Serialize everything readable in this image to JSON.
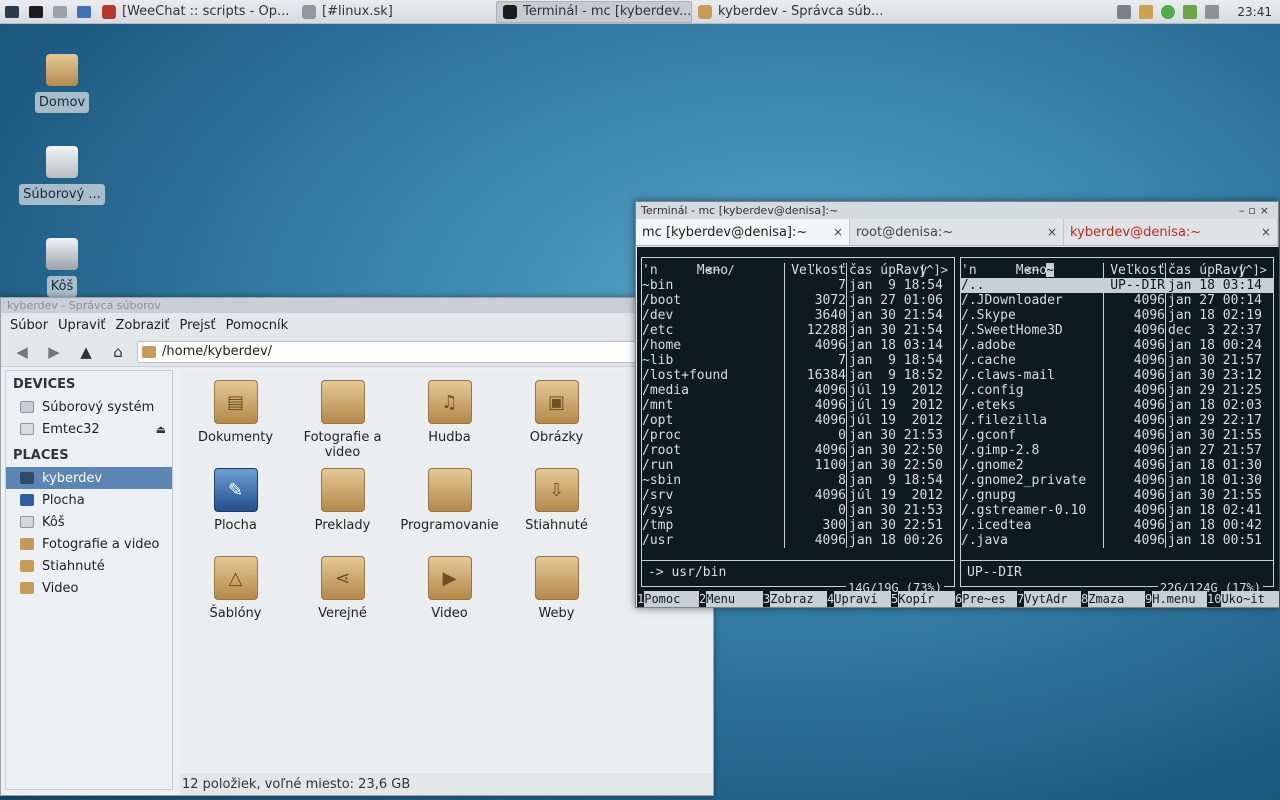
{
  "panel": {
    "tasks": [
      {
        "label": "[WeeChat :: scripts - Op...",
        "active": false
      },
      {
        "label": "[#linux.sk]",
        "active": false
      },
      {
        "label": "Terminál - mc [kyberdev...",
        "active": true
      },
      {
        "label": "kyberdev - Správca súb...",
        "active": false
      }
    ],
    "clock": "23:41"
  },
  "desktop": {
    "icons": [
      {
        "label": "Domov"
      },
      {
        "label": "Súborový ..."
      },
      {
        "label": "Kôš"
      }
    ]
  },
  "filemanager": {
    "title": "kyberdev - Správca súborov",
    "menu": [
      "Súbor",
      "Upraviť",
      "Zobraziť",
      "Prejsť",
      "Pomocník"
    ],
    "path": "/home/kyberdev/",
    "devices_header": "DEVICES",
    "devices": [
      {
        "label": "Súborový systém"
      },
      {
        "label": "Emtec32"
      }
    ],
    "places_header": "PLACES",
    "places": [
      {
        "label": "kyberdev"
      },
      {
        "label": "Plocha"
      },
      {
        "label": "Kôš"
      },
      {
        "label": "Fotografie a video"
      },
      {
        "label": "Stiahnuté"
      },
      {
        "label": "Video"
      }
    ],
    "items": [
      {
        "label": "Dokumenty",
        "icon": "document-folder-icon",
        "glyph": "▤"
      },
      {
        "label": "Fotografie a video",
        "icon": "folder-icon",
        "glyph": ""
      },
      {
        "label": "Hudba",
        "icon": "music-folder-icon",
        "glyph": "♫"
      },
      {
        "label": "Obrázky",
        "icon": "pictures-folder-icon",
        "glyph": "▣"
      },
      {
        "label": "Plocha",
        "icon": "desktop-icon",
        "glyph": "✎"
      },
      {
        "label": "Preklady",
        "icon": "folder-icon",
        "glyph": ""
      },
      {
        "label": "Programovanie",
        "icon": "folder-icon",
        "glyph": ""
      },
      {
        "label": "Stiahnuté",
        "icon": "download-folder-icon",
        "glyph": "⇩"
      },
      {
        "label": "Šablóny",
        "icon": "templates-folder-icon",
        "glyph": "△"
      },
      {
        "label": "Verejné",
        "icon": "public-folder-icon",
        "glyph": "⋖"
      },
      {
        "label": "Video",
        "icon": "video-folder-icon",
        "glyph": "▶"
      },
      {
        "label": "Weby",
        "icon": "folder-icon",
        "glyph": ""
      }
    ],
    "status": "12 položiek, voľné miesto: 23,6 GB"
  },
  "terminal": {
    "title": "Terminál - mc [kyberdev@denisa]:~",
    "tabs": [
      {
        "label": "mc [kyberdev@denisa]:~"
      },
      {
        "label": "root@denisa:~"
      },
      {
        "label": "kyberdev@denisa:~"
      }
    ],
    "left": {
      "header_path": "<─ / ",
      "header_right": ".[^]>",
      "col_name": "'n     Meno",
      "col_size": "Veľkosť",
      "col_time": "čas úpRavy",
      "rows": [
        {
          "name": "~bin",
          "size": "7",
          "time": "jan  9 18:54"
        },
        {
          "name": "/boot",
          "size": "3072",
          "time": "jan 27 01:06"
        },
        {
          "name": "/dev",
          "size": "3640",
          "time": "jan 30 21:54"
        },
        {
          "name": "/etc",
          "size": "12288",
          "time": "jan 30 21:54"
        },
        {
          "name": "/home",
          "size": "4096",
          "time": "jan 18 03:14"
        },
        {
          "name": "~lib",
          "size": "7",
          "time": "jan  9 18:54"
        },
        {
          "name": "/lost+found",
          "size": "16384",
          "time": "jan  9 18:52"
        },
        {
          "name": "/media",
          "size": "4096",
          "time": "júl 19  2012"
        },
        {
          "name": "/mnt",
          "size": "4096",
          "time": "júl 19  2012"
        },
        {
          "name": "/opt",
          "size": "4096",
          "time": "júl 19  2012"
        },
        {
          "name": "/proc",
          "size": "0",
          "time": "jan 30 21:53"
        },
        {
          "name": "/root",
          "size": "4096",
          "time": "jan 30 22:50"
        },
        {
          "name": "/run",
          "size": "1100",
          "time": "jan 30 22:50"
        },
        {
          "name": "~sbin",
          "size": "8",
          "time": "jan  9 18:54"
        },
        {
          "name": "/srv",
          "size": "4096",
          "time": "júl 19  2012"
        },
        {
          "name": "/sys",
          "size": "0",
          "time": "jan 30 21:53"
        },
        {
          "name": "/tmp",
          "size": "300",
          "time": "jan 30 22:51"
        },
        {
          "name": "/usr",
          "size": "4096",
          "time": "jan 18 00:26"
        }
      ],
      "info": "-> usr/bin",
      "free": "14G/19G (73%)"
    },
    "right": {
      "header_path": "<─ ",
      "header_hl": "~",
      "header_right": ".[^]>",
      "col_name": "'n     Meno",
      "col_size": "Veľkosť",
      "col_time": "čas úpRavy",
      "rows": [
        {
          "name": "/..",
          "size": "UP--DIR",
          "time": "jan 18 03:14"
        },
        {
          "name": "/.JDownloader",
          "size": "4096",
          "time": "jan 27 00:14"
        },
        {
          "name": "/.Skype",
          "size": "4096",
          "time": "jan 18 02:19"
        },
        {
          "name": "/.SweetHome3D",
          "size": "4096",
          "time": "dec  3 22:37"
        },
        {
          "name": "/.adobe",
          "size": "4096",
          "time": "jan 18 00:24"
        },
        {
          "name": "/.cache",
          "size": "4096",
          "time": "jan 30 21:57"
        },
        {
          "name": "/.claws-mail",
          "size": "4096",
          "time": "jan 30 23:12"
        },
        {
          "name": "/.config",
          "size": "4096",
          "time": "jan 29 21:25"
        },
        {
          "name": "/.eteks",
          "size": "4096",
          "time": "jan 18 02:03"
        },
        {
          "name": "/.filezilla",
          "size": "4096",
          "time": "jan 29 22:17"
        },
        {
          "name": "/.gconf",
          "size": "4096",
          "time": "jan 30 21:55"
        },
        {
          "name": "/.gimp-2.8",
          "size": "4096",
          "time": "jan 27 21:57"
        },
        {
          "name": "/.gnome2",
          "size": "4096",
          "time": "jan 18 01:30"
        },
        {
          "name": "/.gnome2_private",
          "size": "4096",
          "time": "jan 18 01:30"
        },
        {
          "name": "/.gnupg",
          "size": "4096",
          "time": "jan 30 21:55"
        },
        {
          "name": "/.gstreamer-0.10",
          "size": "4096",
          "time": "jan 18 02:41"
        },
        {
          "name": "/.icedtea",
          "size": "4096",
          "time": "jan 18 00:42"
        },
        {
          "name": "/.java",
          "size": "4096",
          "time": "jan 18 00:51"
        }
      ],
      "info": "UP--DIR",
      "free": "22G/124G (17%)"
    },
    "fkeys": [
      {
        "num": "1",
        "label": "Pomoc"
      },
      {
        "num": "2",
        "label": "Menu"
      },
      {
        "num": "3",
        "label": "Zobraz"
      },
      {
        "num": "4",
        "label": "Upraví"
      },
      {
        "num": "5",
        "label": "Kopír"
      },
      {
        "num": "6",
        "label": "Pre~es"
      },
      {
        "num": "7",
        "label": "VytAdr"
      },
      {
        "num": "8",
        "label": "Zmaza"
      },
      {
        "num": "9",
        "label": "H.menu"
      },
      {
        "num": "10",
        "label": "Uko~it"
      }
    ]
  }
}
